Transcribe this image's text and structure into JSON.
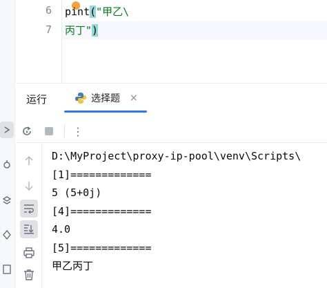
{
  "editor": {
    "lines": [
      {
        "number": "6",
        "code_before": "p",
        "code_mid": "int",
        "paren": "(",
        "string": "\"甲乙\\"
      },
      {
        "number": "7",
        "string": "丙丁\"",
        "paren_close": ")"
      }
    ]
  },
  "run_panel": {
    "title": "运行",
    "tab": {
      "label": "选择题",
      "icon": "python-icon",
      "close": "×"
    },
    "toolbar": {
      "rerun_icon": "rerun-icon",
      "stop_icon": "stop-icon",
      "more_icon": "more-vertical-icon",
      "more_label": "⋮"
    },
    "side_actions": [
      "arrow-up-icon",
      "arrow-down-icon",
      "soft-wrap-icon",
      "scroll-to-end-icon",
      "print-icon",
      "trash-icon"
    ],
    "console_lines": [
      "D:\\MyProject\\proxy-ip-pool\\venv\\Scripts\\",
      "[1]=============",
      "5 (5+0j)",
      "[4]=============",
      "4.0",
      "[5]=============",
      "甲乙丙丁"
    ]
  },
  "colors": {
    "accent": "#3574f0",
    "string": "#067d17",
    "paren_highlight": "#93d9d9",
    "bulb": "#f2a33a"
  }
}
